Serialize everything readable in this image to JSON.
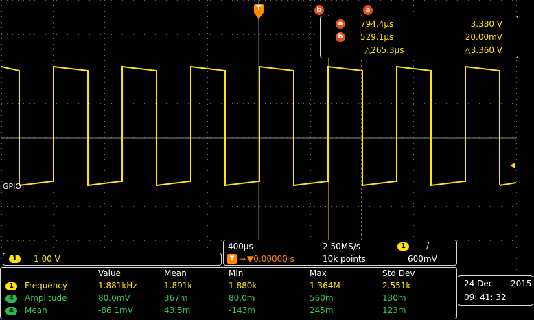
{
  "colors": {
    "trace": "#ffe600",
    "ch4": "#2db84b",
    "cursor": "#e8501a",
    "trigger": "#ff8a00",
    "grid": "#7a7a7a"
  },
  "trigger_marker": "T",
  "cursor_top_labels": {
    "b": "b",
    "a": "a"
  },
  "trace_label": "GPIO",
  "cursor_readout": {
    "a_time": "794.4µs",
    "a_volt": "3.380 V",
    "b_time": "529.1µs",
    "b_volt": "20.00mV",
    "delta_time": "△265.3µs",
    "delta_volt": "△3.360 V"
  },
  "channel_scale": {
    "badge": "1",
    "value": "1.00 V"
  },
  "timebase": {
    "scale": "400µs",
    "sample_rate": "2.50MS/s",
    "trig_badge": "1",
    "trig_slope": "/",
    "position": "▼0.00000 s",
    "record": "10k points",
    "trig_level": "600mV"
  },
  "measurements": {
    "headers": [
      "Value",
      "Mean",
      "Min",
      "Max",
      "Std Dev"
    ],
    "rows": [
      {
        "badge": "1",
        "name": "Frequency",
        "color": "yellow",
        "values": [
          "1.881kHz",
          "1.891k",
          "1.880k",
          "1.364M",
          "2.551k"
        ]
      },
      {
        "badge": "4",
        "name": "Amplitude",
        "color": "green",
        "values": [
          "80.0mV",
          "367m",
          "80.0m",
          "560m",
          "130m"
        ]
      },
      {
        "badge": "4",
        "name": "Mean",
        "color": "green",
        "values": [
          "-86.1mV",
          "43.5m",
          "-143m",
          "245m",
          "123m"
        ]
      }
    ]
  },
  "datetime": {
    "date": "24 Dec",
    "year": "2015",
    "time": "09: 41: 32"
  }
}
